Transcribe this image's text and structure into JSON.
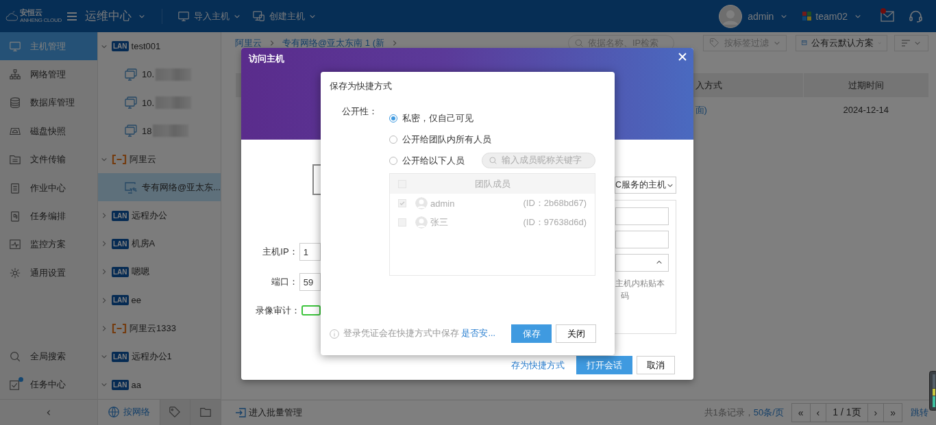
{
  "topbar": {
    "logo_text": "安恒云",
    "logo_subtext": "ANHENG CLOUD",
    "module": "运维中心",
    "actions": [
      {
        "label": "导入主机",
        "kind": "monitor"
      },
      {
        "label": "创建主机",
        "kind": "create"
      }
    ],
    "user": "admin",
    "team": "team02",
    "mail_unread": true
  },
  "nav": {
    "items": [
      {
        "label": "主机管理",
        "kind": "monitor",
        "selected": true
      },
      {
        "label": "网络管理",
        "kind": "network",
        "selected": false
      },
      {
        "label": "数据库管理",
        "kind": "database",
        "selected": false
      },
      {
        "label": "磁盘快照",
        "kind": "disk",
        "selected": false
      },
      {
        "label": "文件传输",
        "kind": "file",
        "selected": false
      },
      {
        "label": "作业中心",
        "kind": "clipboard",
        "selected": false
      },
      {
        "label": "任务编排",
        "kind": "flow",
        "selected": false
      },
      {
        "label": "监控方案",
        "kind": "pulse",
        "selected": false
      },
      {
        "label": "通用设置",
        "kind": "gear",
        "selected": false
      }
    ],
    "bottom_items": [
      {
        "label": "全局搜索",
        "kind": "search",
        "badge": false
      },
      {
        "label": "任务中心",
        "kind": "task",
        "badge": true
      }
    ]
  },
  "tree": {
    "nodes": [
      {
        "label": "test001",
        "kind": "lan",
        "badge": "LAN",
        "expanded": true,
        "selected": false,
        "children": [
          {
            "label": "10.",
            "kind": "host",
            "blurred": true,
            "selected": false
          },
          {
            "label": "10.",
            "kind": "host",
            "blurred": true,
            "selected": false
          },
          {
            "label": "18",
            "kind": "host",
            "blurred": true,
            "selected": false
          }
        ]
      },
      {
        "label": "阿里云",
        "kind": "cloud",
        "expanded": true,
        "selected": false,
        "children": [
          {
            "label": "专有网络@亚太东...",
            "kind": "vpc",
            "blurred": false,
            "selected": true
          }
        ]
      },
      {
        "label": "远程办公",
        "kind": "lan",
        "badge": "LAN",
        "expanded": false,
        "selected": false
      },
      {
        "label": "机房A",
        "kind": "lan",
        "badge": "LAN",
        "expanded": false,
        "selected": false
      },
      {
        "label": "嗯嗯",
        "kind": "lan",
        "badge": "LAN",
        "expanded": false,
        "selected": false
      },
      {
        "label": "ee",
        "kind": "lan",
        "badge": "LAN",
        "expanded": false,
        "selected": false
      },
      {
        "label": "阿里云1333",
        "kind": "cloud",
        "expanded": false,
        "selected": false
      },
      {
        "label": "远程办公1",
        "kind": "lan",
        "badge": "LAN",
        "expanded": true,
        "selected": false
      },
      {
        "label": "aa",
        "kind": "lan",
        "badge": "LAN",
        "expanded": true,
        "selected": false
      }
    ],
    "tabs": [
      {
        "label": "按网络",
        "kind": "globe",
        "selected": true
      },
      {
        "kind": "tag",
        "selected": false
      },
      {
        "kind": "folder",
        "selected": false
      }
    ]
  },
  "main": {
    "breadcrumb": [
      "阿里云",
      "专有网络@亚太东南 1 (新"
    ],
    "search": {
      "placeholder": "依据名称、IP检索"
    },
    "tag_filter": {
      "placeholder": "按标签过滤"
    },
    "scheme": "公有云默认方案",
    "table": {
      "columns": [
        "入方式",
        "过期时间"
      ],
      "rows": [
        [
          "面)",
          "2024-12-14"
        ]
      ]
    },
    "batch": "进入批量管理",
    "total": "共1条记录，",
    "page_size": "50条/页",
    "pager": [
      "«",
      "‹",
      "1 / 1页",
      "›",
      "»"
    ],
    "jump": "跳转"
  },
  "access_dialog": {
    "title": "访问主机",
    "fields": [
      {
        "label": "主机IP：",
        "value": "1"
      },
      {
        "label": "端口：",
        "value": "59"
      }
    ],
    "record_label": "录像审计：",
    "record_on": true,
    "select_value": "C服务的主机",
    "hint_lines": [
      "主机内粘贴本",
      "码"
    ],
    "shortcut_link": "存为快捷方式",
    "open_button": "打开会话",
    "cancel_button": "取消"
  },
  "shortcut_dialog": {
    "title": "保存为快捷方式",
    "visibility_label": "公开性：",
    "options": [
      {
        "label": "私密，仅自己可见",
        "selected": true
      },
      {
        "label": "公开给团队内所有人员",
        "selected": false
      },
      {
        "label": "公开给以下人员",
        "selected": false
      }
    ],
    "member_search": {
      "placeholder": "输入成员昵称关键字"
    },
    "members_header": "团队成员",
    "header_checked": false,
    "members": [
      {
        "name": "admin",
        "id": "(ID：2b68bd67)",
        "checked": true
      },
      {
        "name": "张三",
        "id": "(ID：97638d6d)",
        "checked": false
      }
    ],
    "note": "登录凭证会在快捷方式中保存",
    "note_link": "是否安...",
    "save_button": "保存",
    "close_button": "关闭"
  }
}
